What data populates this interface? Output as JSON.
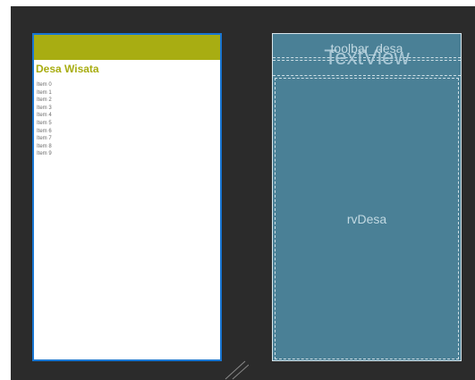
{
  "design": {
    "title": "Desa Wisata",
    "items": [
      "Item 0",
      "Item 1",
      "Item 2",
      "Item 3",
      "Item 4",
      "Item 5",
      "Item 6",
      "Item 7",
      "Item 8",
      "Item 9"
    ],
    "toolbar_color": "#a8ad12",
    "title_color": "#a8ad12",
    "selection_color": "#1976d2"
  },
  "blueprint": {
    "toolbar_label": "toolbar_desa",
    "textview_label": "TextView",
    "recycler_label": "rvDesa",
    "background_color": "#4a8096"
  },
  "canvas": {
    "background_color": "#2b2b2b",
    "resize_icon": "resize-handle-icon"
  }
}
